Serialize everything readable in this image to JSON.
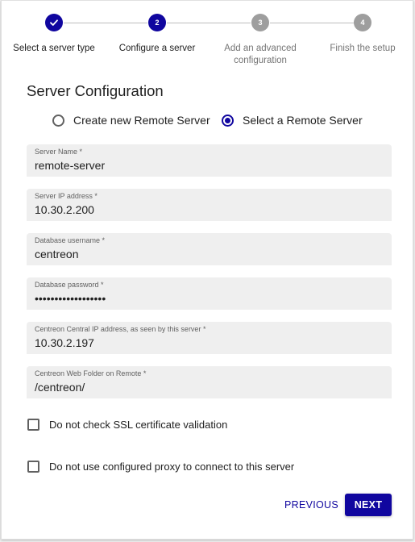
{
  "stepper": {
    "steps": [
      {
        "number": "1",
        "label": "Select a server type",
        "state": "done"
      },
      {
        "number": "2",
        "label": "Configure a server",
        "state": "active"
      },
      {
        "number": "3",
        "label": "Add an advanced configuration",
        "state": "todo"
      },
      {
        "number": "4",
        "label": "Finish the setup",
        "state": "todo"
      }
    ]
  },
  "form": {
    "title": "Server Configuration",
    "radio_options": [
      {
        "label": "Create new Remote Server",
        "checked": false
      },
      {
        "label": "Select a Remote Server",
        "checked": true
      }
    ],
    "fields": [
      {
        "label": "Server Name *",
        "value": "remote-server"
      },
      {
        "label": "Server IP address *",
        "value": "10.30.2.200"
      },
      {
        "label": "Database username *",
        "value": "centreon"
      },
      {
        "label": "Database password *",
        "value": "••••••••••••••••••"
      },
      {
        "label": "Centreon Central IP address, as seen by this server *",
        "value": "10.30.2.197"
      },
      {
        "label": "Centreon Web Folder on Remote *",
        "value": "/centreon/"
      }
    ],
    "checkboxes": [
      {
        "label": "Do not check SSL certificate validation",
        "checked": false
      },
      {
        "label": "Do not use configured proxy to connect to this server",
        "checked": false
      }
    ]
  },
  "actions": {
    "previous_label": "PREVIOUS",
    "next_label": "NEXT"
  },
  "colors": {
    "primary": "#10069f",
    "inactive_step": "#9e9e9e",
    "field_background": "#efefef"
  }
}
